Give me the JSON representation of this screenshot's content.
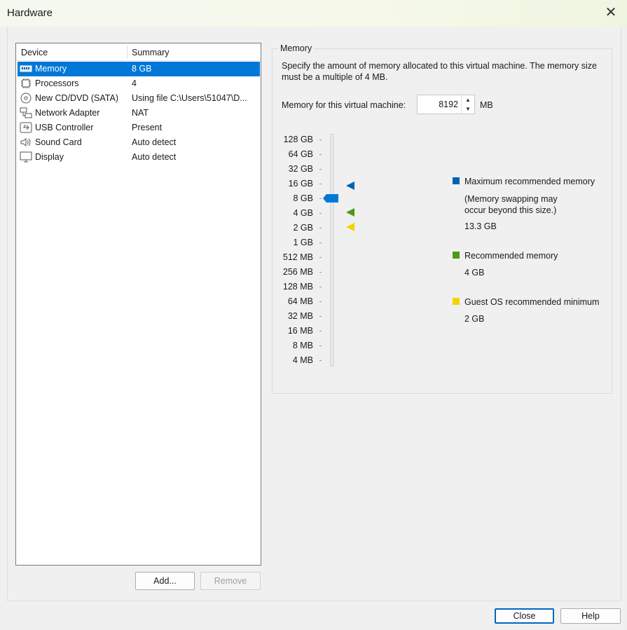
{
  "window": {
    "title": "Hardware"
  },
  "device_list": {
    "headers": {
      "device": "Device",
      "summary": "Summary"
    },
    "items": [
      {
        "name": "Memory",
        "summary": "8 GB",
        "icon": "memory-icon",
        "selected": true
      },
      {
        "name": "Processors",
        "summary": "4",
        "icon": "processor-icon",
        "selected": false
      },
      {
        "name": "New CD/DVD (SATA)",
        "summary": "Using file C:\\Users\\51047\\D...",
        "icon": "cd-dvd-icon",
        "selected": false
      },
      {
        "name": "Network Adapter",
        "summary": "NAT",
        "icon": "network-icon",
        "selected": false
      },
      {
        "name": "USB Controller",
        "summary": "Present",
        "icon": "usb-icon",
        "selected": false
      },
      {
        "name": "Sound Card",
        "summary": "Auto detect",
        "icon": "speaker-icon",
        "selected": false
      },
      {
        "name": "Display",
        "summary": "Auto detect",
        "icon": "monitor-icon",
        "selected": false
      }
    ],
    "add_label": "Add...",
    "remove_label": "Remove"
  },
  "memory_panel": {
    "group_title": "Memory",
    "description": "Specify the amount of memory allocated to this virtual machine. The memory size must be a multiple of 4 MB.",
    "field_label": "Memory for this virtual machine:",
    "field_value": "8192",
    "unit": "MB",
    "scale_labels": [
      "128 GB",
      "64 GB",
      "32 GB",
      "16 GB",
      "8 GB",
      "4 GB",
      "2 GB",
      "1 GB",
      "512 MB",
      "256 MB",
      "128 MB",
      "64 MB",
      "32 MB",
      "16 MB",
      "8 MB",
      "4 MB"
    ],
    "slider_value": "8 GB",
    "legend": {
      "max": {
        "label": "Maximum recommended memory",
        "note": "(Memory swapping may\noccur beyond this size.)",
        "value": "13.3 GB",
        "color": "#0063b1"
      },
      "recommended": {
        "label": "Recommended memory",
        "value": "4 GB",
        "color": "#4a9b16"
      },
      "guest_min": {
        "label": "Guest OS recommended minimum",
        "value": "2 GB",
        "color": "#f2d500"
      }
    },
    "thumb_color": "#0078d7"
  },
  "footer": {
    "close_label": "Close",
    "help_label": "Help"
  }
}
